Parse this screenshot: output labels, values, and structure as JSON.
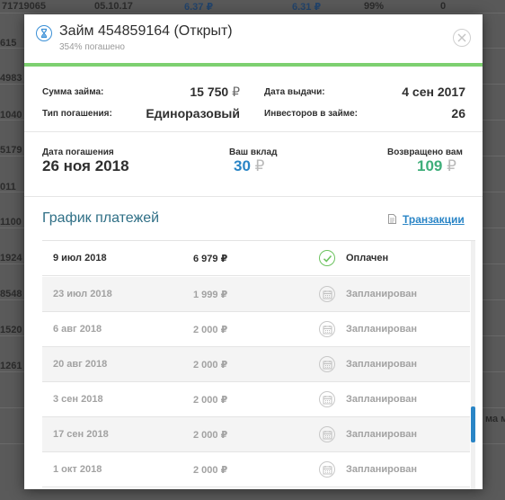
{
  "background": {
    "top_row": [
      "71719065",
      "05.10.17",
      "6.37 ₽",
      "6.31 ₽",
      "99%",
      "0"
    ],
    "left_ids": [
      "615",
      "4983",
      "1040",
      "5179",
      "011",
      "1100",
      "1924",
      "8548",
      "1520",
      "1261"
    ],
    "right_fragment": "ма мо"
  },
  "modal": {
    "title": "Займ 454859164 (Открыт)",
    "subtitle": "354% погашено",
    "details": {
      "amount_label": "Сумма займа:",
      "amount_value": "15 750",
      "issue_date_label": "Дата выдачи:",
      "issue_date_value": "4 сен 2017",
      "repayment_type_label": "Тип погашения:",
      "repayment_type_value": "Единоразовый",
      "investors_label": "Инвесторов в займе:",
      "investors_value": "26",
      "currency": "₽"
    },
    "summary": {
      "due_date_label": "Дата погашения",
      "due_date_value": "26 ноя 2018",
      "contribution_label": "Ваш вклад",
      "contribution_value": "30",
      "returned_label": "Возвращено вам",
      "returned_value": "109",
      "currency": "₽"
    },
    "schedule_title": "График платежей",
    "transactions_label": "Транзакции",
    "payments": [
      {
        "date": "9 июл 2018",
        "amount": "6 979 ₽",
        "status": "Оплачен"
      },
      {
        "date": "23 июл 2018",
        "amount": "1 999 ₽",
        "status": "Запланирован"
      },
      {
        "date": "6 авг 2018",
        "amount": "2 000 ₽",
        "status": "Запланирован"
      },
      {
        "date": "20 авг 2018",
        "amount": "2 000 ₽",
        "status": "Запланирован"
      },
      {
        "date": "3 сен 2018",
        "amount": "2 000 ₽",
        "status": "Запланирован"
      },
      {
        "date": "17 сен 2018",
        "amount": "2 000 ₽",
        "status": "Запланирован"
      },
      {
        "date": "1 окт 2018",
        "amount": "2 000 ₽",
        "status": "Запланирован"
      }
    ],
    "colors": {
      "accent_green": "#7dd070",
      "link_blue": "#2a85c6",
      "returned_green": "#3fae7a"
    }
  }
}
